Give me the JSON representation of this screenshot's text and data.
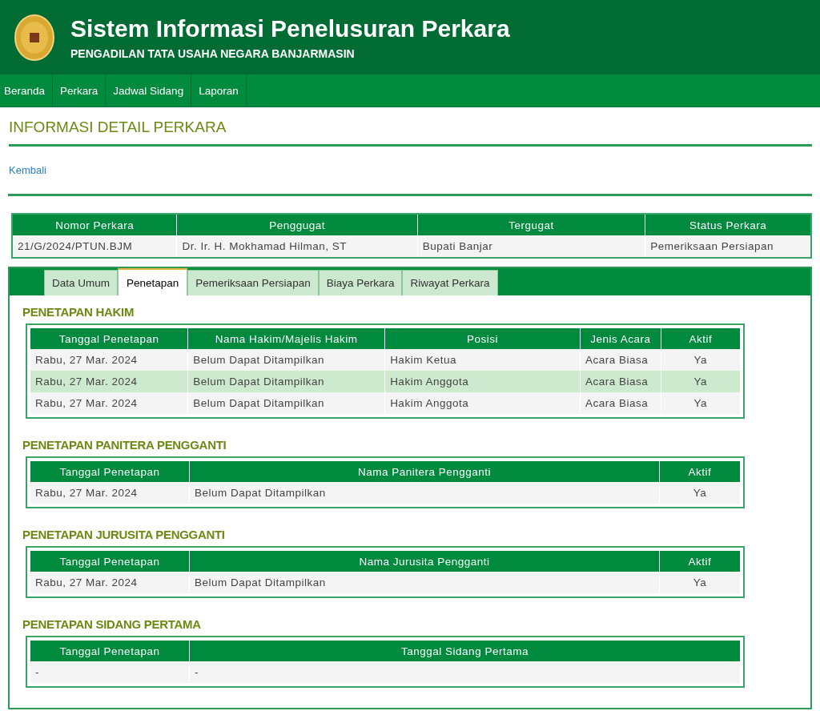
{
  "header": {
    "title": "Sistem Informasi Penelusuran Perkara",
    "subtitle": "PENGADILAN TATA USAHA NEGARA BANJARMASIN"
  },
  "nav": {
    "items": [
      "Beranda",
      "Perkara",
      "Jadwal Sidang",
      "Laporan"
    ]
  },
  "page_title": "INFORMASI DETAIL PERKARA",
  "back_link": "Kembali",
  "summary": {
    "columns": [
      "Nomor Perkara",
      "Penggugat",
      "Tergugat",
      "Status Perkara"
    ],
    "rows": [
      {
        "cells": [
          "21/G/2024/PTUN.BJM",
          "Dr. Ir. H. Mokhamad Hilman, ST",
          "Bupati Banjar",
          "Pemeriksaan Persiapan"
        ],
        "highlighted": false
      }
    ]
  },
  "tabs": [
    {
      "label": "Data Umum",
      "selected": false
    },
    {
      "label": "Penetapan",
      "selected": true
    },
    {
      "label": "Pemeriksaan Persiapan",
      "selected": false
    },
    {
      "label": "Biaya Perkara",
      "selected": false
    },
    {
      "label": "Riwayat Perkara",
      "selected": false
    }
  ],
  "sections": [
    {
      "title": "PENETAPAN HAKIM",
      "table": {
        "columns": [
          "Tanggal Penetapan",
          "Nama Hakim/Majelis Hakim",
          "Posisi",
          "Jenis Acara",
          "Aktif"
        ],
        "rows": [
          {
            "cells": [
              "Rabu, 27 Mar. 2024",
              "Belum Dapat Ditampilkan",
              "Hakim Ketua",
              "Acara Biasa",
              "Ya"
            ],
            "highlighted": false
          },
          {
            "cells": [
              "Rabu, 27 Mar. 2024",
              "Belum Dapat Ditampilkan",
              "Hakim Anggota",
              "Acara Biasa",
              "Ya"
            ],
            "highlighted": true
          },
          {
            "cells": [
              "Rabu, 27 Mar. 2024",
              "Belum Dapat Ditampilkan",
              "Hakim Anggota",
              "Acara Biasa",
              "Ya"
            ],
            "highlighted": false
          }
        ]
      }
    },
    {
      "title": "PENETAPAN PANITERA PENGGANTI",
      "table": {
        "columns": [
          "Tanggal Penetapan",
          "Nama Panitera Pengganti",
          "Aktif"
        ],
        "rows": [
          {
            "cells": [
              "Rabu, 27 Mar. 2024",
              "Belum Dapat Ditampilkan",
              "Ya"
            ],
            "highlighted": false
          }
        ]
      }
    },
    {
      "title": "PENETAPAN JURUSITA PENGGANTI",
      "table": {
        "columns": [
          "Tanggal Penetapan",
          "Nama Jurusita Pengganti",
          "Aktif"
        ],
        "rows": [
          {
            "cells": [
              "Rabu, 27 Mar. 2024",
              "Belum Dapat Ditampilkan",
              "Ya"
            ],
            "highlighted": false
          }
        ]
      }
    },
    {
      "title": "PENETAPAN SIDANG PERTAMA",
      "table": {
        "columns": [
          "Tanggal Penetapan",
          "Tanggal Sidang Pertama"
        ],
        "rows": [
          {
            "cells": [
              "-",
              "-"
            ],
            "highlighted": false
          }
        ]
      }
    }
  ]
}
